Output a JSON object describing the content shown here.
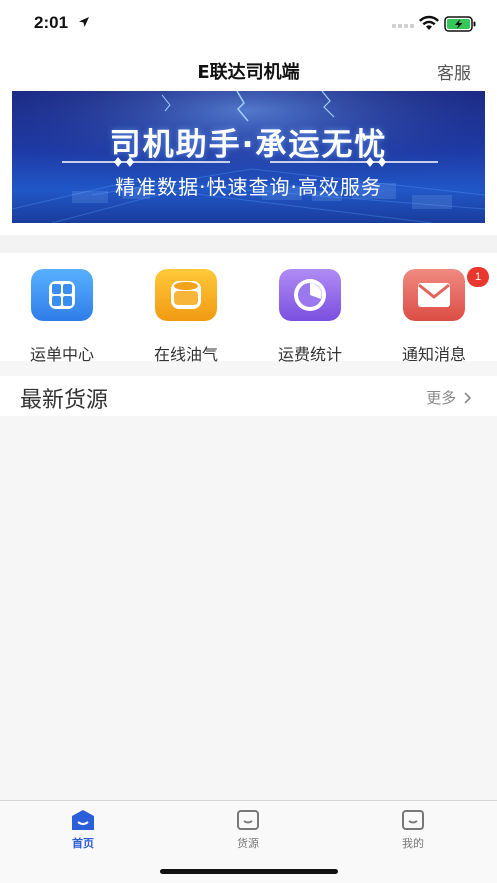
{
  "status_bar": {
    "time": "2:01"
  },
  "nav": {
    "title": "E联达司机端",
    "service_label": "客服"
  },
  "banner": {
    "title": "司机助手·承运无忧",
    "subtitle": "精准数据·快速查询·高效服务"
  },
  "shortcuts": [
    {
      "label": "运单中心",
      "icon": "grid-icon",
      "color": "#3a8ef0"
    },
    {
      "label": "在线油气",
      "icon": "fuel-tank-icon",
      "color": "#f3a21b"
    },
    {
      "label": "运费统计",
      "icon": "pie-chart-icon",
      "color": "#8a63e6"
    },
    {
      "label": "通知消息",
      "icon": "mail-icon",
      "color": "#e5625a",
      "badge": "1"
    }
  ],
  "section": {
    "title": "最新货源",
    "more_label": "更多"
  },
  "tabs": [
    {
      "label": "首页",
      "icon": "home-icon",
      "active": true
    },
    {
      "label": "货源",
      "icon": "cargo-icon",
      "active": false
    },
    {
      "label": "我的",
      "icon": "profile-icon",
      "active": false
    }
  ],
  "colors": {
    "accent": "#2a5fd9",
    "badge": "#e8372f"
  }
}
